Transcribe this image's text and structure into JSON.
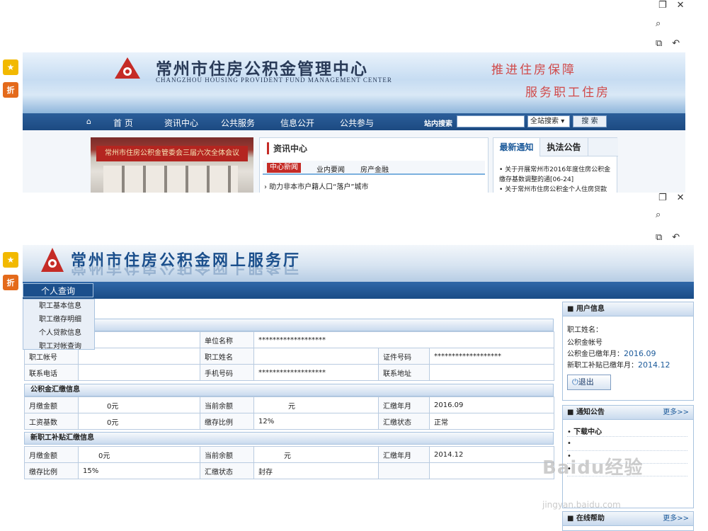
{
  "top": {
    "title": "常州市住房公积金管理中心",
    "subtitle": "CHANGZHOU HOUSING PROVIDENT FUND MANAGEMENT CENTER",
    "slogan_1": "推进住房保障",
    "slogan_2": "服务职工住房",
    "nav": [
      "首 页",
      "资讯中心",
      "公共服务",
      "信息公开",
      "公共参与"
    ],
    "search_label": "站内搜索",
    "search_scope": "全站搜索",
    "search_button": "搜 索",
    "photo_caption": "常州市住房公积金管委会三届六次全体会议",
    "news": {
      "title": "资讯中心",
      "tab_active": "中心新闻",
      "tab_2": "业内要闻",
      "tab_3": "房产金融",
      "item_1": "助力非本市户籍人口“落户”城市"
    },
    "notice": {
      "tab_active": "最新通知",
      "tab_2": "执法公告",
      "text": "• 关于开展常州市2016年度住房公积金缴存基数调整的通[06-24]",
      "text_2": "• 关于常州市住房公积金个人住房贷款"
    }
  },
  "hall": {
    "title": "常州市住房公积金网上服务厅",
    "menu_head": "个人查询",
    "menu_items": [
      "职工基本信息",
      "职工缴存明细",
      "个人贷款信息",
      "职工对帐查询"
    ],
    "section_1": {
      "rows": [
        [
          "**",
          "单位名称",
          "*******************",
          "",
          ""
        ],
        [
          "职工帐号",
          "",
          "职工姓名",
          "",
          "证件号码",
          "*******************"
        ],
        [
          "联系电话",
          "",
          "手机号码",
          "*******************",
          "联系地址",
          ""
        ]
      ]
    },
    "section_2": {
      "title": "公积金汇缴信息",
      "r1": {
        "l1": "月缴金额",
        "v1": "0元",
        "l2": "当前余额",
        "v2": "元",
        "l3": "汇缴年月",
        "v3": "2016.09"
      },
      "r2": {
        "l1": "工资基数",
        "v1": "0元",
        "l2": "缴存比例",
        "v2": "12%",
        "l3": "汇缴状态",
        "v3": "正常"
      }
    },
    "section_3": {
      "title": "新职工补贴汇缴信息",
      "r1": {
        "l1": "月缴金额",
        "v1": "0元",
        "l2": "当前余额",
        "v2": "元",
        "l3": "汇缴年月",
        "v3": "2014.12"
      },
      "r2": {
        "l1": "缴存比例",
        "v1": "15%",
        "l2": "汇缴状态",
        "v2": "封存"
      }
    },
    "user_box": {
      "title": "用户信息",
      "name_label": "职工姓名：",
      "account_label": "公积金帐号",
      "fund_label": "公积金已缴年月：",
      "fund_value": "2016.09",
      "subsidy_label": "新职工补贴已缴年月：",
      "subsidy_value": "2014.12",
      "logout": "退出"
    },
    "notice_box": {
      "title": "通知公告",
      "more": "更多>>",
      "item_1": "下载中心"
    },
    "help_box": {
      "title": "在线帮助",
      "more": "更多>>"
    }
  },
  "watermark": {
    "text": "Baidu经验",
    "sub": "jingyan.baidu.com"
  },
  "colors": {
    "nav_blue": "#1c4a82",
    "accent_red": "#c52b26",
    "link_blue": "#1c5a9a"
  }
}
